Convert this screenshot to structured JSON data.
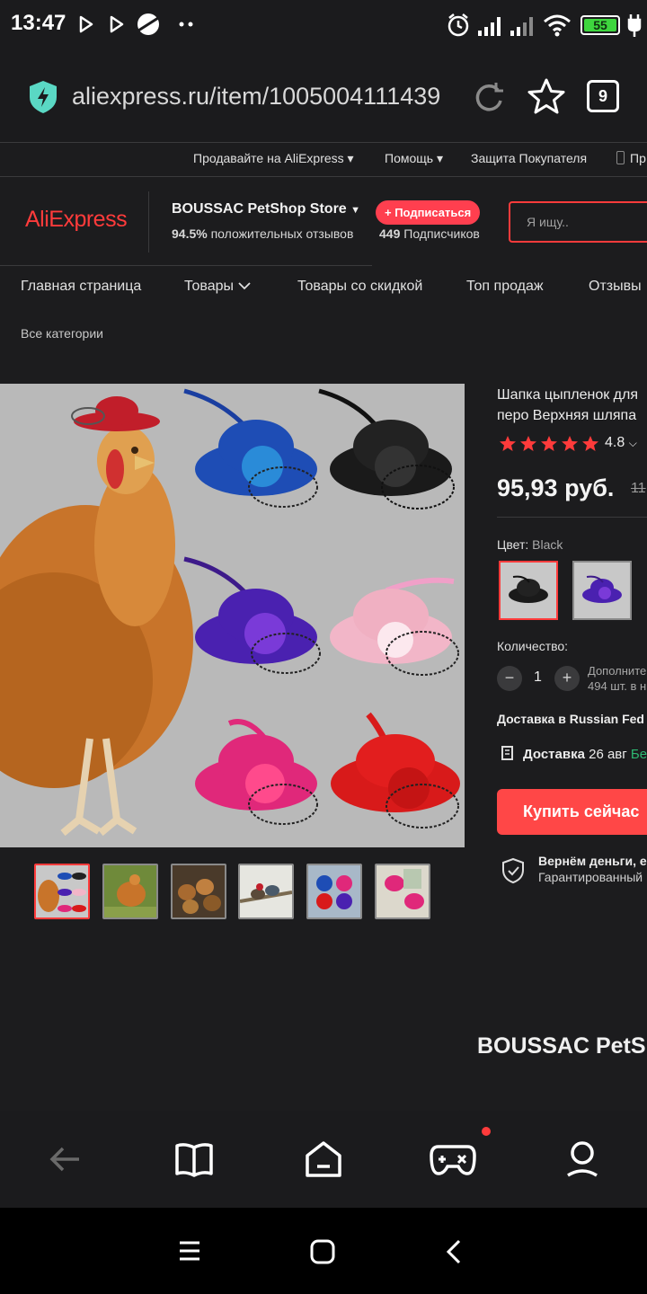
{
  "status_bar": {
    "time": "13:47",
    "battery": "55",
    "icons": [
      "play-store-icon",
      "play-icon",
      "planet-icon",
      "more-dots-icon",
      "alarm-icon",
      "signal-icon",
      "signal-2-icon",
      "wifi-icon",
      "battery-icon",
      "charging-icon"
    ]
  },
  "browser": {
    "url": "aliexpress.ru/item/1005004111439",
    "tab_count": "9",
    "icons": [
      "shield-lightning-icon",
      "reload-icon",
      "star-icon",
      "tabs-icon"
    ]
  },
  "top_nav": {
    "sell": "Продавайте на AliExpress",
    "help": "Помощь",
    "protection": "Защита Покупателя",
    "app": "Пр"
  },
  "store": {
    "logo": "AliExpress",
    "name": "BOUSSAC PetShop Store",
    "positive_pct": "94.5%",
    "positive_label": "положительных отзывов",
    "subscribe": "+ Подписаться",
    "followers_count": "449",
    "followers_label": "Подписчиков"
  },
  "search": {
    "placeholder": "Я ищу.."
  },
  "menu": {
    "home": "Главная страница",
    "products": "Товары",
    "discount": "Товары со скидкой",
    "top": "Топ продаж",
    "reviews": "Отзывы",
    "all_categories": "Все категории"
  },
  "product": {
    "title": "Шапка цыпленок для перо Верхняя шляпа",
    "rating": "4.8",
    "stars": 5,
    "price": "95,93 руб.",
    "old_price": "11",
    "color_label": "Цвет:",
    "color_value": "Black",
    "quantity_label": "Количество:",
    "quantity": "1",
    "extra_line1": "Дополните",
    "extra_line2": "494 шт. в н",
    "delivery_line": "Доставка в Russian Fed",
    "delivery_label": "Доставка",
    "delivery_date": "26 авг",
    "delivery_extra": "Бе",
    "buy_now": "Купить сейчас",
    "guarantee_title": "Вернём деньги, е",
    "guarantee_sub": "Гарантированный"
  },
  "store_section_title": "BOUSSAC PetS",
  "bottom_bar": {
    "icons": [
      "back-arrow-icon",
      "book-icon",
      "home-icon",
      "gamepad-icon",
      "profile-icon"
    ]
  },
  "system_nav": {
    "icons": [
      "menu-icon",
      "home-square-icon",
      "back-icon"
    ]
  },
  "colors": {
    "accent": "#ff3b3b",
    "buy_button": "#ff4747",
    "subscribe": "#ff3f4f",
    "free_green": "#2eb872",
    "battery": "#3ed63e",
    "background": "#1c1c1e"
  }
}
